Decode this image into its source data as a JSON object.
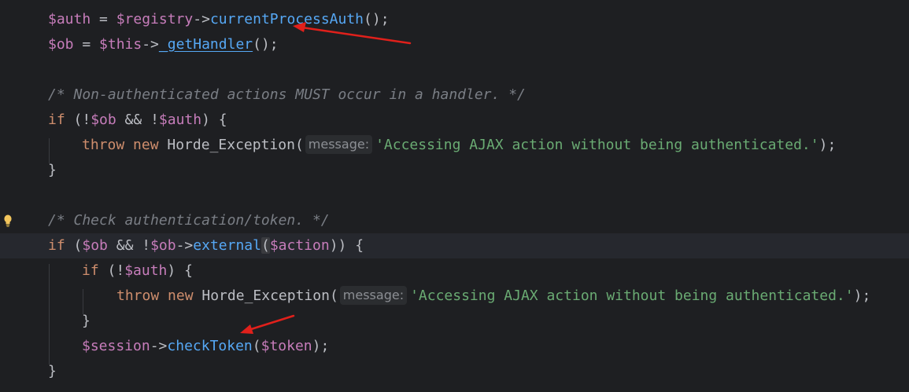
{
  "code": {
    "line1": {
      "auth_var": "$auth",
      "eq": " = ",
      "registry_var": "$registry",
      "arrow": "->",
      "method": "currentProcessAuth",
      "tail": "();"
    },
    "line2": {
      "ob_var": "$ob",
      "eq": " = ",
      "this_var": "$this",
      "arrow": "->",
      "method": "_getHandler",
      "tail": "();"
    },
    "comment1": "/* Non-authenticated actions MUST occur in a handler. */",
    "if1": {
      "kw": "if",
      "open": " (!",
      "ob_var": "$ob",
      "op": " && !",
      "auth_var": "$auth",
      "close": ") {"
    },
    "throw1": {
      "throw_kw": "throw",
      "new_kw": " new",
      "cls": " Horde_Exception(",
      "hint": "message:",
      "str": "'Accessing AJAX action without being authenticated.'",
      "tail": ");"
    },
    "brace1": "}",
    "comment2": "/* Check authentication/token. */",
    "if2": {
      "kw": "if",
      "open": " (",
      "ob_var": "$ob",
      "op": " && !",
      "ob_var2": "$ob",
      "arrow": "->",
      "method": "external",
      "paren": "(",
      "action_var": "$action",
      "close": ")) {"
    },
    "if3": {
      "kw": "if",
      "open": " (!",
      "auth_var": "$auth",
      "close": ") {"
    },
    "throw2": {
      "throw_kw": "throw",
      "new_kw": " new",
      "cls": " Horde_Exception(",
      "hint": "message:",
      "str": "'Accessing AJAX action without being authenticated.'",
      "tail": ");"
    },
    "brace2": "}",
    "session_line": {
      "session_var": "$session",
      "arrow": "->",
      "method": "checkToken",
      "paren": "(",
      "token_var": "$token",
      "tail": ");"
    },
    "brace3": "}"
  },
  "gutter": {
    "bulb_icon": "lightbulb-icon"
  },
  "annotations": {
    "arrow_color": "#e0201b"
  }
}
